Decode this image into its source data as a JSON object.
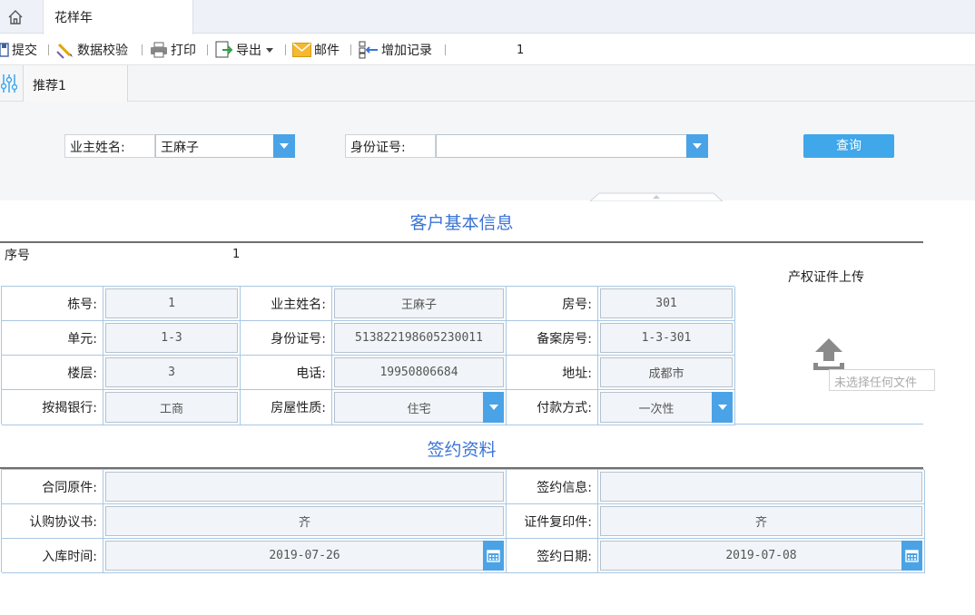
{
  "tabs": {
    "active_label": "花样年"
  },
  "toolbar": {
    "submit": "提交",
    "validate": "数据校验",
    "print": "打印",
    "export": "导出",
    "mail": "邮件",
    "add_record": "增加记录",
    "page_number": "1"
  },
  "subtabs": {
    "recommend": "推荐1"
  },
  "query": {
    "owner_label": "业主姓名:",
    "owner_value": "王麻子",
    "id_label": "身份证号:",
    "id_value": "",
    "button": "查询"
  },
  "customer": {
    "title": "客户基本信息",
    "seq_label": "序号",
    "seq_value": "1",
    "upload_label": "产权证件上传",
    "upload_status": "未选择任何文件",
    "fields": {
      "building_label": "栋号:",
      "building": "1",
      "owner_label": "业主姓名:",
      "owner": "王麻子",
      "room_label": "房号:",
      "room": "301",
      "unit_label": "单元:",
      "unit": "1-3",
      "id_label": "身份证号:",
      "id": "513822198605230011",
      "record_room_label": "备案房号:",
      "record_room": "1-3-301",
      "floor_label": "楼层:",
      "floor": "3",
      "phone_label": "电话:",
      "phone": "19950806684",
      "address_label": "地址:",
      "address": "成都市",
      "bank_label": "按揭银行:",
      "bank": "工商",
      "house_type_label": "房屋性质:",
      "house_type": "住宅",
      "payment_label": "付款方式:",
      "payment": "一次性"
    }
  },
  "contract": {
    "title": "签约资料",
    "original_label": "合同原件:",
    "original": "",
    "sign_info_label": "签约信息:",
    "sign_info": "",
    "purchase_label": "认购协议书:",
    "purchase": "齐",
    "copy_label": "证件复印件:",
    "copy": "齐",
    "storage_label": "入库时间:",
    "storage_date": "2019-07-26",
    "sign_date_label": "签约日期:",
    "sign_date": "2019-07-08"
  },
  "colors": {
    "accent": "#3b74d6",
    "button": "#3fa7ea",
    "border": "#a8c7e3"
  }
}
